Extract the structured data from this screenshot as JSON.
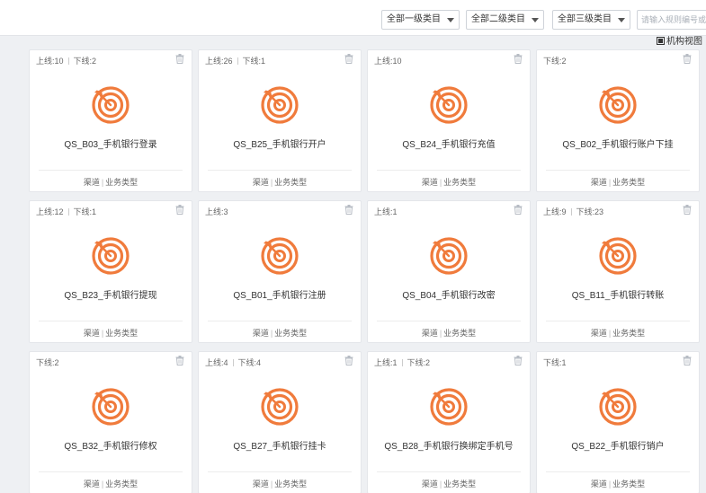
{
  "filters": {
    "level1": "全部一级类目",
    "level2": "全部二级类目",
    "level3": "全部三级类目",
    "search_placeholder": "请输入规则编号或名称"
  },
  "view_toggle_label": "机构视图",
  "colors": {
    "accent": "#f07b3c",
    "page_bg": "#eef0f3",
    "card_bg": "#ffffff"
  },
  "icons": {
    "card_icon": "target-icon",
    "delete_icon": "trash-icon"
  },
  "cards": [
    {
      "stats": [
        {
          "label": "上线:10"
        },
        {
          "label": "下线:2"
        }
      ],
      "title": "QS_B03_手机银行登录",
      "channel": "渠道",
      "biz_type": "业务类型"
    },
    {
      "stats": [
        {
          "label": "上线:26"
        },
        {
          "label": "下线:1"
        }
      ],
      "title": "QS_B25_手机银行开户",
      "channel": "渠道",
      "biz_type": "业务类型"
    },
    {
      "stats": [
        {
          "label": "上线:10"
        }
      ],
      "title": "QS_B24_手机银行充值",
      "channel": "渠道",
      "biz_type": "业务类型"
    },
    {
      "stats": [
        {
          "label": "下线:2"
        }
      ],
      "title": "QS_B02_手机银行账户下挂",
      "channel": "渠道",
      "biz_type": "业务类型"
    },
    {
      "stats": [
        {
          "label": "上线:12"
        },
        {
          "label": "下线:1"
        }
      ],
      "title": "QS_B23_手机银行提现",
      "channel": "渠道",
      "biz_type": "业务类型"
    },
    {
      "stats": [
        {
          "label": "上线:3"
        }
      ],
      "title": "QS_B01_手机银行注册",
      "channel": "渠道",
      "biz_type": "业务类型"
    },
    {
      "stats": [
        {
          "label": "上线:1"
        }
      ],
      "title": "QS_B04_手机银行改密",
      "channel": "渠道",
      "biz_type": "业务类型"
    },
    {
      "stats": [
        {
          "label": "上线:9"
        },
        {
          "label": "下线:23"
        }
      ],
      "title": "QS_B11_手机银行转账",
      "channel": "渠道",
      "biz_type": "业务类型"
    },
    {
      "stats": [
        {
          "label": "下线:2"
        }
      ],
      "title": "QS_B32_手机银行修权",
      "channel": "渠道",
      "biz_type": "业务类型"
    },
    {
      "stats": [
        {
          "label": "上线:4"
        },
        {
          "label": "下线:4"
        }
      ],
      "title": "QS_B27_手机银行挂卡",
      "channel": "渠道",
      "biz_type": "业务类型"
    },
    {
      "stats": [
        {
          "label": "上线:1"
        },
        {
          "label": "下线:2"
        }
      ],
      "title": "QS_B28_手机银行换绑定手机号",
      "channel": "渠道",
      "biz_type": "业务类型"
    },
    {
      "stats": [
        {
          "label": "下线:1"
        }
      ],
      "title": "QS_B22_手机银行销户",
      "channel": "渠道",
      "biz_type": "业务类型"
    }
  ]
}
